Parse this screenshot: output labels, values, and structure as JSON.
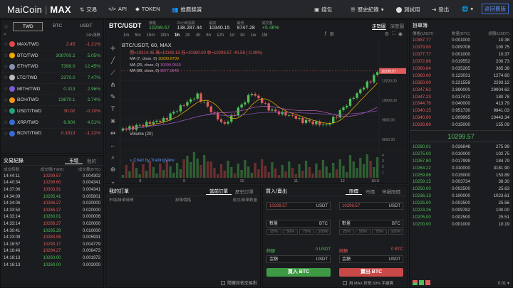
{
  "topbar": {
    "logo_main": "MaiCoin",
    "logo_sep": "|",
    "logo_max": "MAX",
    "nav": [
      "交易",
      "API",
      "TOKEN",
      "推薦獎賞"
    ],
    "right": [
      "錢包",
      "歷史紀錄",
      "測試用",
      "登出"
    ],
    "back": "返回舊版"
  },
  "market": {
    "tabs": [
      "TWD",
      "BTC",
      "USDT"
    ],
    "active": "TWD",
    "sort": "24h漲跌",
    "coins": [
      {
        "name": "MAX/TWD",
        "price": "2.45",
        "chg": "-1.21%",
        "up": false,
        "color": "#e04848"
      },
      {
        "name": "BTC/TWD",
        "price": "308700.2",
        "chg": "5.05%",
        "up": true,
        "color": "#f2a900"
      },
      {
        "name": "ETH/TWD",
        "price": "7399.0",
        "chg": "12.45%",
        "up": true,
        "color": "#8a92b2"
      },
      {
        "name": "LTC/TWD",
        "price": "2370.0",
        "chg": "7.47%",
        "up": true,
        "color": "#bfbbbb"
      },
      {
        "name": "MITH/TWD",
        "price": "0.313",
        "chg": "2.96%",
        "up": true,
        "color": "#7a5bd1"
      },
      {
        "name": "BCH/TWD",
        "price": "13870.1",
        "chg": "2.74%",
        "up": true,
        "color": "#f7931a"
      },
      {
        "name": "USDT/TWD",
        "price": "30.02",
        "chg": "-0.10%",
        "up": false,
        "color": "#26a17b"
      },
      {
        "name": "XRP/TWD",
        "price": "8.600",
        "chg": "4.51%",
        "up": true,
        "color": "#3a6bd1"
      },
      {
        "name": "BCNT/TWD",
        "price": "0.3313",
        "chg": "-1.22%",
        "up": false,
        "color": "#3a6bd1"
      }
    ]
  },
  "trades": {
    "title": "交易紀錄",
    "tabs": [
      "市場",
      "我的"
    ],
    "headers": [
      "成交時間",
      "成交價(TWD)",
      "成交量(BTC)"
    ],
    "rows": [
      [
        "14:44:11",
        "10299.57",
        "0.004302",
        false
      ],
      [
        "14:40:34",
        "10299.60",
        "0.004341",
        false
      ],
      [
        "14:37:06",
        "10303.91",
        "0.004341",
        false
      ],
      [
        "14:34:09",
        "10295.41",
        "0.005801",
        true
      ],
      [
        "14:34:06",
        "10286.27",
        "0.020000",
        false
      ],
      [
        "14:33:50",
        "10286.27",
        "0.020000",
        false
      ],
      [
        "14:33:14",
        "10280.01",
        "0.000006",
        true
      ],
      [
        "14:33:14",
        "10288.27",
        "0.020000",
        false
      ],
      [
        "14:30:41",
        "10285.28",
        "0.010000",
        true
      ],
      [
        "14:23:09",
        "10283.06",
        "0.005931",
        false
      ],
      [
        "14:16:57",
        "10293.17",
        "0.004779",
        false
      ],
      [
        "14:16:46",
        "10294.27",
        "0.006473",
        false
      ],
      [
        "14:16:13",
        "10260.00",
        "0.001972",
        true
      ],
      [
        "14:16:13",
        "10260.00",
        "0.002000",
        true
      ]
    ]
  },
  "chart": {
    "pair": "BTC/USDT",
    "stats": {
      "labels": [
        "價格",
        "24小時漲跌",
        "最高",
        "最低",
        "成交量"
      ],
      "values": [
        "10299.57",
        "138.287.44",
        "10340.15",
        "9747.28",
        "+5.46%"
      ]
    },
    "tabs": [
      "走勢圖",
      "深度圖"
    ],
    "timeframes": [
      "1m",
      "5m",
      "15m",
      "30m",
      "1h",
      "2h",
      "4h",
      "6h",
      "12h",
      "1d",
      "3d",
      "1w",
      "1M"
    ],
    "active_tf": "1h",
    "title": "BTC/USDT, 60, MAX",
    "ohlc": "開=10314.45 高=10340.15 低=10260.00 收=10299.57 -40.58 (-0.39%)",
    "ma": [
      "MA (7, close, 0)",
      "MA (25, close, 0)",
      "MA (99, close, 0)"
    ],
    "ma_vals": [
      "10290.6700",
      "10094.0560",
      "9877.0648"
    ],
    "volume": "Volume (20)",
    "xticks": [
      "8",
      "9",
      "10",
      "11",
      "12",
      "18:0"
    ],
    "yticks": [
      "10200.00",
      "10000.00",
      "9800.00",
      "9600.00"
    ],
    "vticks": [
      "4",
      "3",
      "2",
      "1"
    ],
    "last": "10299.57",
    "credit": "Chart by TradingView"
  },
  "orders": {
    "title": "我的訂單",
    "tabs": [
      "當前訂單",
      "歷史訂單"
    ],
    "headers": [
      "市場/掛單時間",
      "掛單價格",
      "成交/掛單數量"
    ],
    "hide": "隱藏其他交易對"
  },
  "trade": {
    "title": "買入/賣出",
    "tabs": [
      "限價",
      "市價",
      "停損限價"
    ],
    "price": "10299.57",
    "unit": "USDT",
    "qty": "數量",
    "qunit": "BTC",
    "pcts": [
      "25%",
      "50%",
      "75%",
      "100%"
    ],
    "avail": "餘額",
    "buy_avail": "0 USDT",
    "sell_avail": "0 BTC",
    "total": "金額",
    "buy": "買入 BTC",
    "sell": "賣出 BTC",
    "fee": "用 MAX 折抵 50% 手續費"
  },
  "book": {
    "title": "掛單簿",
    "headers": [
      "價格(USDT)",
      "數量(BTC)",
      "總額(USDT)"
    ],
    "asks": [
      [
        "10387.77",
        "0.001000",
        "10.38"
      ],
      [
        "10379.00",
        "0.009708",
        "100.75"
      ],
      [
        "10377.77",
        "0.001000",
        "10.37"
      ],
      [
        "10372.86",
        "0.019552",
        "200.73"
      ],
      [
        "10360.84",
        "0.035285",
        "365.38"
      ],
      [
        "10360.00",
        "0.123031",
        "1274.60"
      ],
      [
        "10350.00",
        "0.221558",
        "2293.12"
      ],
      [
        "10347.62",
        "2.890000",
        "29904.62"
      ],
      [
        "10347.23",
        "0.017472",
        "180.78"
      ],
      [
        "10344.76",
        "0.040000",
        "413.79"
      ],
      [
        "10340.15",
        "0.951730",
        "9841.03"
      ],
      [
        "10340.00",
        "1.009995",
        "10443.34"
      ],
      [
        "10339.89",
        "0.015000",
        "155.09"
      ]
    ],
    "last": "10299.57",
    "bids": [
      [
        "10280.01",
        "0.026848",
        "275.99"
      ],
      [
        "10275.00",
        "0.010000",
        "102.75"
      ],
      [
        "10267.80",
        "0.017999",
        "184.79"
      ],
      [
        "10264.22",
        "0.310000",
        "3181.90"
      ],
      [
        "10259.86",
        "0.015000",
        "153.89"
      ],
      [
        "10259.15",
        "0.003734",
        "38.30"
      ],
      [
        "10250.00",
        "0.002500",
        "25.63"
      ],
      [
        "10236.13",
        "0.100000",
        "1023.61"
      ],
      [
        "10225.00",
        "0.002500",
        "25.56"
      ],
      [
        "10223.26",
        "0.009782",
        "100.00"
      ],
      [
        "10205.00",
        "0.002500",
        "25.51"
      ],
      [
        "10200.00",
        "0.001000",
        "10.19"
      ]
    ],
    "depth": "0.01"
  },
  "colors": {
    "red": "#e25b5b",
    "green": "#4fbf5a",
    "buy": "#3f9a45",
    "sell": "#c94848"
  }
}
